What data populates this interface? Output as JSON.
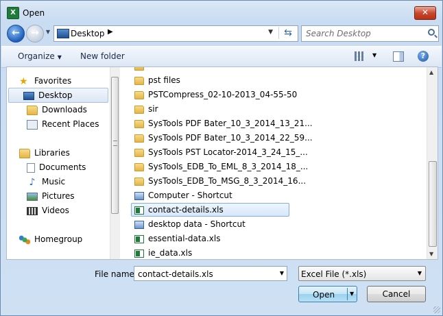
{
  "window": {
    "title": "Open",
    "app_icon": "excel-icon",
    "close": "✕"
  },
  "nav": {
    "back": "back-arrow-icon",
    "forward": "forward-arrow-icon",
    "address": {
      "crumb": "Desktop",
      "icon": "desktop-icon"
    },
    "search_placeholder": "Search Desktop"
  },
  "toolbar": {
    "organize": "Organize",
    "new_folder": "New folder"
  },
  "sidebar": {
    "items": [
      {
        "label": "Favorites",
        "icon": "star-icon"
      },
      {
        "label": "Desktop",
        "icon": "desktop-icon",
        "selected": true
      },
      {
        "label": "Downloads",
        "icon": "downloads-folder-icon"
      },
      {
        "label": "Recent Places",
        "icon": "recent-places-icon"
      },
      {
        "label": "Libraries",
        "icon": "libraries-icon"
      },
      {
        "label": "Documents",
        "icon": "documents-icon"
      },
      {
        "label": "Music",
        "icon": "music-icon"
      },
      {
        "label": "Pictures",
        "icon": "pictures-icon"
      },
      {
        "label": "Videos",
        "icon": "videos-icon"
      },
      {
        "label": "Homegroup",
        "icon": "homegroup-icon"
      }
    ]
  },
  "files": [
    {
      "name": "pst files",
      "type": "folder"
    },
    {
      "name": "PSTCompress_02-10-2013_04-55-50",
      "type": "folder"
    },
    {
      "name": "sir",
      "type": "folder"
    },
    {
      "name": "SysTools PDF Bater_10_3_2014_13_21...",
      "type": "folder"
    },
    {
      "name": "SysTools PDF Bater_10_3_2014_22_59...",
      "type": "folder"
    },
    {
      "name": "SysTools PST Locator-2014_3_24_15_...",
      "type": "folder"
    },
    {
      "name": "SysTools_EDB_To_EML_8_3_2014_18_...",
      "type": "folder"
    },
    {
      "name": "SysTools_EDB_To_MSG_8_3_2014_16...",
      "type": "folder"
    },
    {
      "name": "Computer - Shortcut",
      "type": "shortcut"
    },
    {
      "name": "contact-details.xls",
      "type": "xls",
      "selected": true
    },
    {
      "name": "desktop data - Shortcut",
      "type": "shortcut"
    },
    {
      "name": "essential-data.xls",
      "type": "xls"
    },
    {
      "name": "ie_data.xls",
      "type": "xls"
    }
  ],
  "bottom": {
    "file_name_label": "File name:",
    "file_name_value": "contact-details.xls",
    "file_type": "Excel File (*.xls)",
    "open": "Open",
    "cancel": "Cancel"
  }
}
